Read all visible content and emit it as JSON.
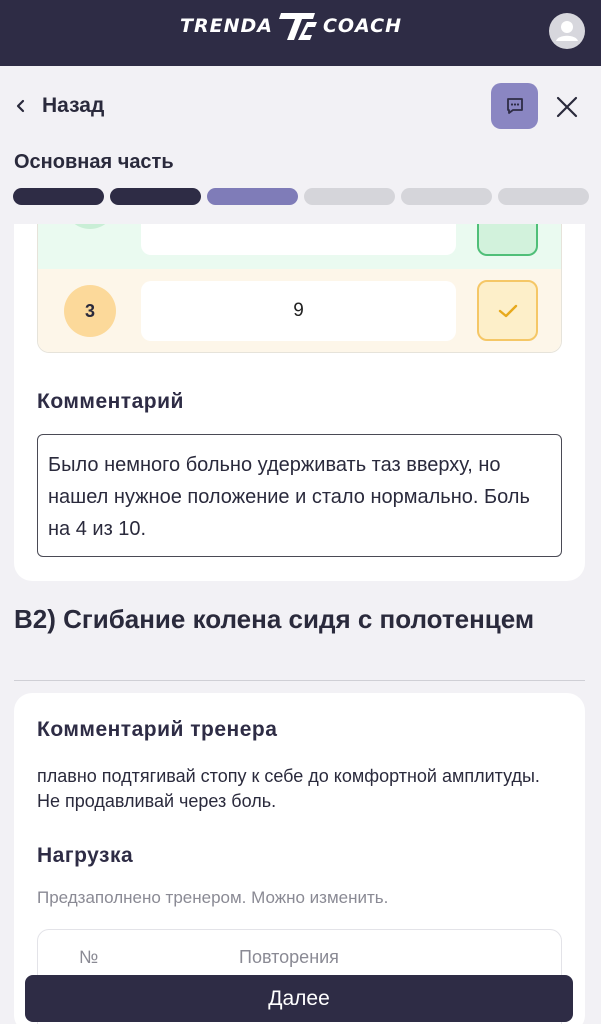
{
  "app": {
    "logo_left": "TRENDA",
    "logo_right": "COACH"
  },
  "header": {
    "back_label": "Назад",
    "section_title": "Основная часть",
    "progress": {
      "total": 6,
      "completed": 2,
      "current": 3
    },
    "colors": {
      "done": "#2e2c45",
      "current": "#7f7cb8",
      "todo": "#d5d5da"
    }
  },
  "sets": [
    {
      "number": "",
      "value": "",
      "status": "done",
      "color": "green"
    },
    {
      "number": "3",
      "value": "9",
      "status": "done",
      "color": "orange"
    }
  ],
  "comment": {
    "label": "Комментарий",
    "text": "Было немного больно удерживать таз вверху, но нашел нужное положение и стало нормально. Боль на 4 из 10."
  },
  "exercise": {
    "title": "B2) Сгибание колена сидя с полотенцем",
    "coach_label": "Комментарий тренера",
    "coach_text": "плавно подтягивай стопу к себе до комфортной амплитуды. Не продавливай через боль.",
    "load_label": "Нагрузка",
    "load_hint": "Предзаполнено тренером. Можно изменить.",
    "table_headers": [
      "№",
      "Повторения"
    ]
  },
  "footer": {
    "next_label": "Далее"
  }
}
